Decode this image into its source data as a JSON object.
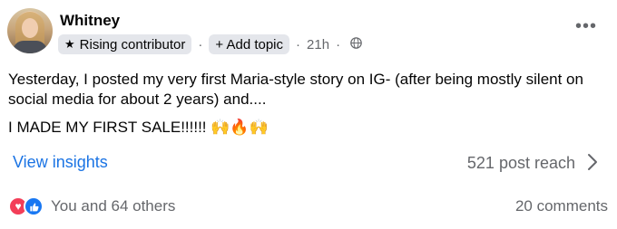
{
  "post": {
    "author": "Whitney",
    "badge_label": "Rising contributor",
    "add_topic_label": "+ Add topic",
    "time": "21h",
    "more_label": "•••",
    "text": "Yesterday, I posted my very first Maria-style story on IG- (after being mostly silent on social media for about 2 years) and....",
    "text2": "I MADE MY FIRST SALE!!!!!! 🙌🔥🙌",
    "view_insights": "View insights",
    "reach": "521 post reach",
    "reactions_text": "You and 64 others",
    "comments": "20 comments"
  },
  "icons": {
    "badge": "star-icon",
    "audience": "globe-icon",
    "more": "more-icon",
    "reach": "chevron-right-icon",
    "love": "love-reaction-icon",
    "like": "like-reaction-icon"
  },
  "colors": {
    "link": "#1b74e4",
    "secondary": "#65676b",
    "love": "#f33e58",
    "like": "#1877f2"
  }
}
